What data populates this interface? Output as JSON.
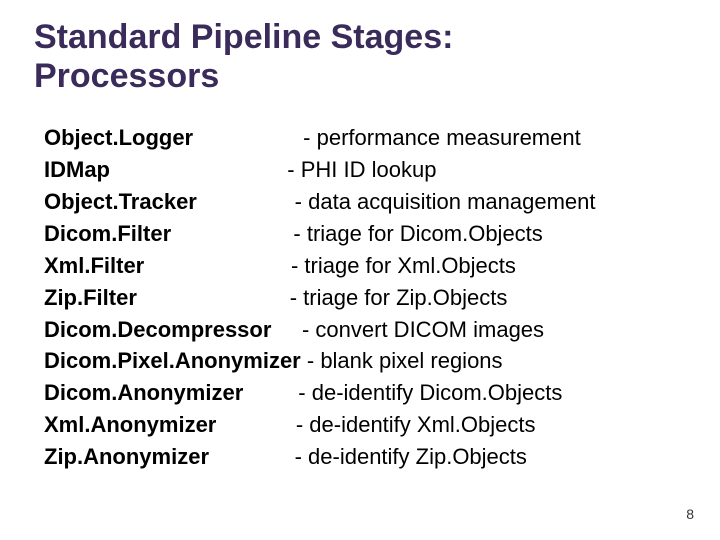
{
  "title_line1": "Standard Pipeline Stages:",
  "title_line2": "Processors",
  "rows": [
    {
      "name": "Object.Logger",
      "pad": "                  ",
      "desc": "- performance measurement"
    },
    {
      "name": "IDMap",
      "pad": "                             ",
      "desc": "- PHI ID lookup"
    },
    {
      "name": "Object.Tracker",
      "pad": "                ",
      "desc": "- data acquisition management"
    },
    {
      "name": "Dicom.Filter",
      "pad": "                    ",
      "desc": "- triage for Dicom.Objects"
    },
    {
      "name": "Xml.Filter",
      "pad": "                        ",
      "desc": "- triage for Xml.Objects"
    },
    {
      "name": "Zip.Filter",
      "pad": "                         ",
      "desc": "- triage for Zip.Objects"
    },
    {
      "name": "Dicom.Decompressor",
      "pad": "     ",
      "desc": "- convert DICOM images"
    },
    {
      "name": "Dicom.Pixel.Anonymizer",
      "pad": " ",
      "desc": "- blank pixel regions"
    },
    {
      "name": "Dicom.Anonymizer",
      "pad": "         ",
      "desc": "- de-identify Dicom.Objects"
    },
    {
      "name": "Xml.Anonymizer",
      "pad": "             ",
      "desc": "- de-identify Xml.Objects"
    },
    {
      "name": "Zip.Anonymizer",
      "pad": "              ",
      "desc": "- de-identify Zip.Objects"
    }
  ],
  "page_number": "8"
}
